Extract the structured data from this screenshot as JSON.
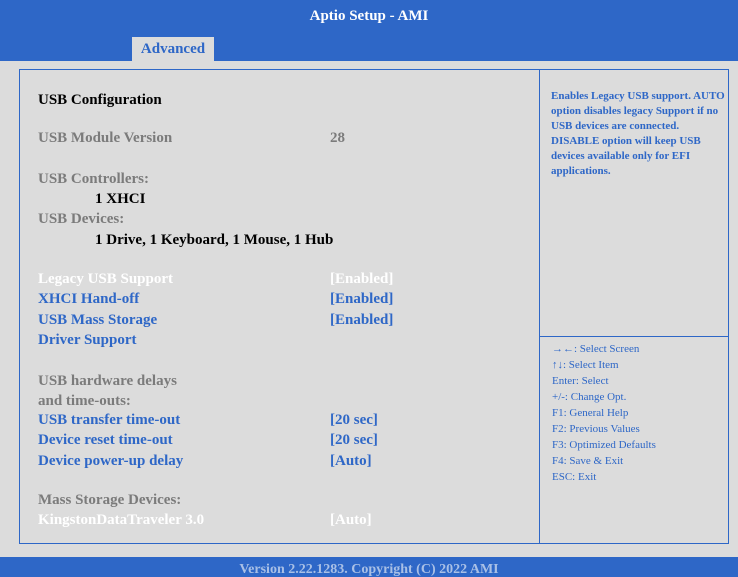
{
  "window": {
    "title": "Aptio Setup - AMI"
  },
  "tabs": [
    {
      "label": "Advanced",
      "active": true
    }
  ],
  "main": {
    "section_title": "USB Configuration",
    "module_version": {
      "label": "USB Module Version",
      "value": "28"
    },
    "controllers": {
      "label": "USB Controllers:",
      "value": "1 XHCI"
    },
    "devices": {
      "label": "USB Devices:",
      "value": "1 Drive, 1 Keyboard, 1 Mouse, 1 Hub"
    },
    "legacy_usb": {
      "label": "Legacy USB Support",
      "value": "[Enabled]"
    },
    "xhci_handoff": {
      "label": "XHCI Hand-off",
      "value": "[Enabled]"
    },
    "mass_storage": {
      "label_line1": "USB Mass Storage",
      "label_line2": "Driver Support",
      "value": "[Enabled]"
    },
    "delays_heading": {
      "line1": "USB hardware delays",
      "line2": "and time-outs:"
    },
    "transfer_timeout": {
      "label": "USB transfer time-out",
      "value": "[20 sec]"
    },
    "reset_timeout": {
      "label": "Device reset time-out",
      "value": "[20 sec]"
    },
    "powerup_delay": {
      "label": "Device power-up delay",
      "value": "[Auto]"
    },
    "mass_storage_devices": {
      "label": "Mass Storage Devices:"
    },
    "kingston": {
      "label": "KingstonDataTraveler 3.0",
      "value": "[Auto]"
    }
  },
  "help": {
    "text": "Enables Legacy USB support. AUTO option disables legacy Support if no USB devices are connected. DISABLE option will keep USB devices available only for EFI applications."
  },
  "keys": [
    "→←: Select Screen",
    "↑↓: Select Item",
    "Enter: Select",
    "+/-: Change Opt.",
    "F1: General Help",
    "F2: Previous Values",
    "F3: Optimized Defaults",
    "F4: Save & Exit",
    "ESC: Exit"
  ],
  "footer": {
    "text": "Version 2.22.1283. Copyright (C) 2022 AMI"
  },
  "colors": {
    "accent": "#2e67c7",
    "panel": "#dcdcdc",
    "selected_text": "#ffffff",
    "disabled_text": "#7b7b7b"
  }
}
